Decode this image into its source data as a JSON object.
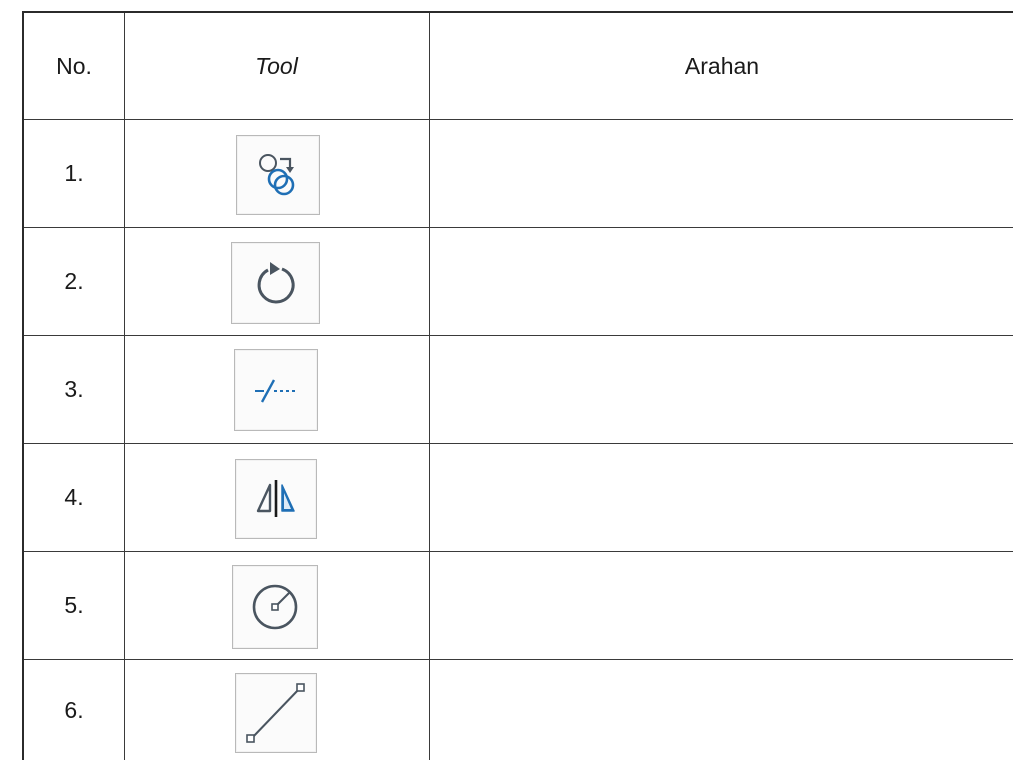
{
  "table": {
    "headers": {
      "no": "No.",
      "tool": "Tool",
      "arahan": "Arahan"
    },
    "rows": [
      {
        "no": "1.",
        "icon": "translate-by-vector-icon",
        "arahan": ""
      },
      {
        "no": "2.",
        "icon": "rotate-around-point-icon",
        "arahan": ""
      },
      {
        "no": "3.",
        "icon": "perpendicular-bisector-icon",
        "arahan": ""
      },
      {
        "no": "4.",
        "icon": "reflect-about-line-icon",
        "arahan": ""
      },
      {
        "no": "5.",
        "icon": "circle-with-center-icon",
        "arahan": ""
      },
      {
        "no": "6.",
        "icon": "segment-icon",
        "arahan": ""
      }
    ]
  },
  "colors": {
    "icon_blue": "#1f6fb5",
    "icon_gray": "#4a5560",
    "border": "#2b2b2b"
  }
}
